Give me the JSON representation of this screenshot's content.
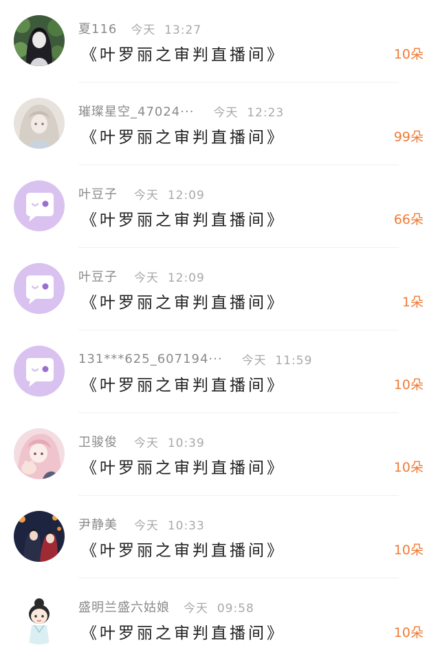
{
  "items": [
    {
      "username": "夏116",
      "day": "今天",
      "time": "13:27",
      "title": "《叶罗丽之审判直播间》",
      "gift": "10朵",
      "avatar": "avatar-dark-hair-girl"
    },
    {
      "username": "璀璨星空_47024···",
      "day": "今天",
      "time": "12:23",
      "title": "《叶罗丽之审判直播间》",
      "gift": "99朵",
      "avatar": "avatar-white-hair-girl"
    },
    {
      "username": "叶豆子",
      "day": "今天",
      "time": "12:09",
      "title": "《叶罗丽之审判直播间》",
      "gift": "66朵",
      "avatar": "default-chat-avatar"
    },
    {
      "username": "叶豆子",
      "day": "今天",
      "time": "12:09",
      "title": "《叶罗丽之审判直播间》",
      "gift": "1朵",
      "avatar": "default-chat-avatar"
    },
    {
      "username": "131***625_607194···",
      "day": "今天",
      "time": "11:59",
      "title": "《叶罗丽之审判直播间》",
      "gift": "10朵",
      "avatar": "default-chat-avatar"
    },
    {
      "username": "卫骏俊",
      "day": "今天",
      "time": "10:39",
      "title": "《叶罗丽之审判直播间》",
      "gift": "10朵",
      "avatar": "avatar-pink-hair-girl"
    },
    {
      "username": "尹静美",
      "day": "今天",
      "time": "10:33",
      "title": "《叶罗丽之审判直播间》",
      "gift": "10朵",
      "avatar": "avatar-night-scene"
    },
    {
      "username": "盛明兰盛六姑娘",
      "day": "今天",
      "time": "09:58",
      "title": "《叶罗丽之审判直播间》",
      "gift": "10朵",
      "avatar": "avatar-chibi-girl"
    }
  ],
  "colors": {
    "gift": "#f07a34",
    "default_avatar_bg": "#d9c2f0",
    "default_avatar_dot": "#9a6fd0"
  }
}
